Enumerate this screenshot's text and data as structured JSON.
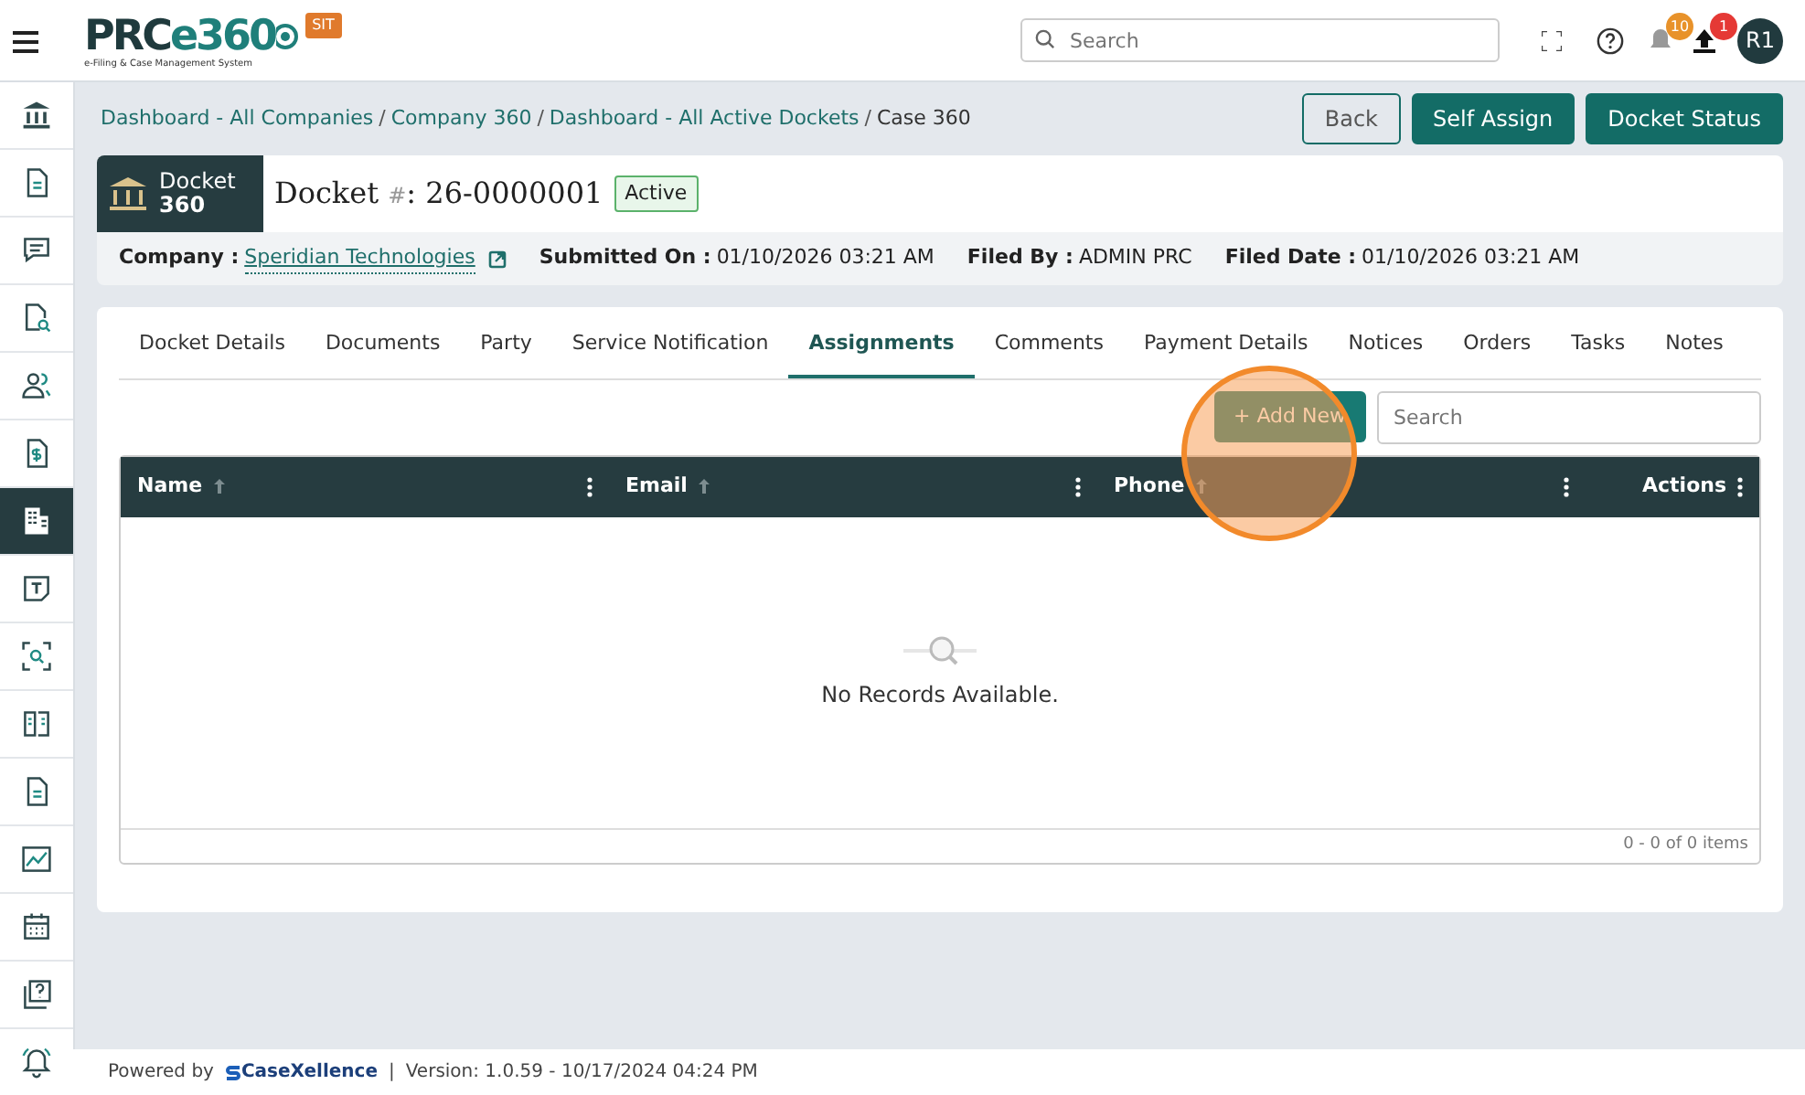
{
  "header": {
    "logo": {
      "main": "PRC",
      "accent": "e360",
      "subtitle": "e-Filing & Case Management System",
      "badge": "SIT"
    },
    "search": {
      "placeholder": "Search"
    },
    "notifications": "10",
    "uploads": "1",
    "avatar": "R1"
  },
  "sidebar": {
    "items": [
      {
        "selected": false
      },
      {
        "selected": false
      },
      {
        "selected": false
      },
      {
        "selected": false
      },
      {
        "selected": false
      },
      {
        "selected": false
      },
      {
        "selected": true
      },
      {
        "selected": false
      },
      {
        "selected": false
      },
      {
        "selected": false
      },
      {
        "selected": false
      },
      {
        "selected": false
      },
      {
        "selected": false
      },
      {
        "selected": false
      },
      {
        "selected": false
      }
    ]
  },
  "breadcrumb": [
    {
      "text": "Dashboard - All Companies",
      "kind": "link"
    },
    {
      "text": "/",
      "kind": "separator"
    },
    {
      "text": "Company 360",
      "kind": "link"
    },
    {
      "text": "/",
      "kind": "separator"
    },
    {
      "text": "Dashboard - All Active Dockets",
      "kind": "link"
    },
    {
      "text": "/",
      "kind": "separator"
    },
    {
      "text": "Case 360",
      "kind": "current"
    }
  ],
  "actions": [
    {
      "label": "Back",
      "kind": "outline"
    },
    {
      "label": "Self Assign",
      "kind": "solid"
    },
    {
      "label": "Docket Status",
      "kind": "solid"
    }
  ],
  "docket": {
    "badge_line1": "Docket",
    "badge_line2": "360",
    "title": "Docket",
    "hash": "#",
    "number": ": 26-0000001",
    "status": "Active",
    "meta": [
      {
        "label": "Company :",
        "value": "Speridian Technologies",
        "kind": "link"
      },
      {
        "label": "Submitted On :",
        "value": "01/10/2026 03:21 AM",
        "kind": "text"
      },
      {
        "label": "Filed By :",
        "value": "ADMIN PRC",
        "kind": "text"
      },
      {
        "label": "Filed Date :",
        "value": "01/10/2026 03:21 AM",
        "kind": "text"
      }
    ]
  },
  "tabs": [
    {
      "label": "Docket Details",
      "selected": false
    },
    {
      "label": "Documents",
      "selected": false
    },
    {
      "label": "Party",
      "selected": false
    },
    {
      "label": "Service Notification",
      "selected": false
    },
    {
      "label": "Assignments",
      "selected": true
    },
    {
      "label": "Comments",
      "selected": false
    },
    {
      "label": "Payment Details",
      "selected": false
    },
    {
      "label": "Notices",
      "selected": false
    },
    {
      "label": "Orders",
      "selected": false
    },
    {
      "label": "Tasks",
      "selected": false
    },
    {
      "label": "Notes",
      "selected": false
    }
  ],
  "add_button": "+ Add New",
  "grid_search": {
    "placeholder": "Search"
  },
  "table": {
    "columns": [
      {
        "label": "Name",
        "sortable": true
      },
      {
        "label": "Email",
        "sortable": true
      },
      {
        "label": "Phone",
        "sortable": true
      },
      {
        "label": "Actions",
        "sortable": false
      }
    ],
    "empty": "No Records Available.",
    "pager": "0 - 0 of 0 items"
  },
  "footer": {
    "powered": "Powered by",
    "brand": "CaseXellence",
    "sep": "|",
    "version": "Version: 1.0.59 - 10/17/2024 04:24 PM"
  }
}
